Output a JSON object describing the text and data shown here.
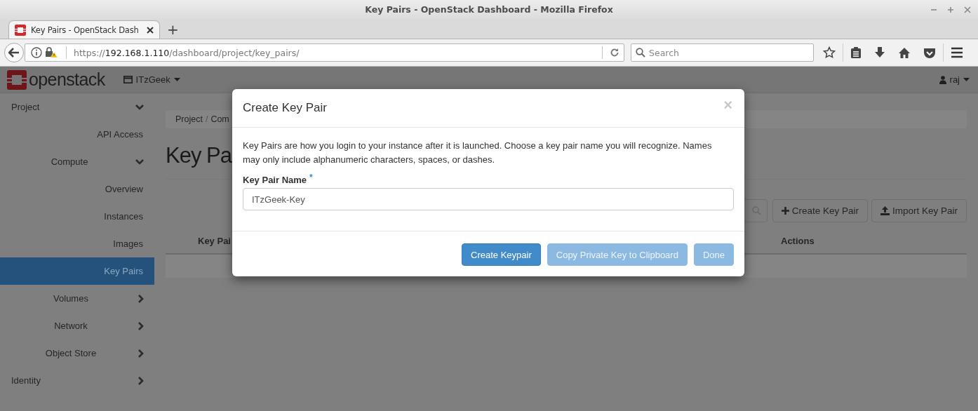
{
  "window": {
    "title": "Key Pairs - OpenStack Dashboard - Mozilla Firefox"
  },
  "tabs": [
    {
      "label": "Key Pairs - OpenStack Dash",
      "selected": true
    }
  ],
  "new_tab": "+",
  "address_bar": {
    "scheme": "https://",
    "host": "192.168.1.110",
    "path": "/dashboard/project/key_pairs/"
  },
  "search": {
    "placeholder": "Search"
  },
  "header": {
    "logo": "openstack",
    "project": "ITzGeek",
    "user": "raj"
  },
  "sidebar": {
    "items": [
      {
        "kind": "group",
        "label": "Project",
        "expanded": true,
        "children": [
          {
            "kind": "link",
            "label": "API Access",
            "selected": false
          },
          {
            "kind": "group",
            "label": "Compute",
            "expanded": true,
            "children": [
              {
                "kind": "link",
                "label": "Overview",
                "selected": false
              },
              {
                "kind": "link",
                "label": "Instances",
                "selected": false
              },
              {
                "kind": "link",
                "label": "Images",
                "selected": false
              },
              {
                "kind": "link",
                "label": "Key Pairs",
                "selected": true
              }
            ]
          },
          {
            "kind": "group",
            "label": "Volumes",
            "expanded": false
          },
          {
            "kind": "group",
            "label": "Network",
            "expanded": false
          },
          {
            "kind": "group",
            "label": "Object Store",
            "expanded": false
          }
        ]
      },
      {
        "kind": "group",
        "label": "Identity",
        "expanded": false
      }
    ]
  },
  "breadcrumb": {
    "items": [
      "Project",
      "Com"
    ],
    "separator": "/"
  },
  "page_title": "Key Pa",
  "actions": [
    {
      "label": "Create Key Pair",
      "kind": "create"
    },
    {
      "label": "Import Key Pair",
      "kind": "import"
    }
  ],
  "table": {
    "columns": [
      "Key Pai",
      "Actions"
    ]
  },
  "modal": {
    "title": "Create Key Pair",
    "close": "×",
    "description": "Key Pairs are how you login to your instance after it is launched. Choose a key pair name you will recognize. Names may only include alphanumeric characters, spaces, or dashes.",
    "field": {
      "label": "Key Pair Name",
      "required_mark": "*",
      "value": "ITzGeek-Key"
    },
    "buttons": [
      {
        "label": "Create Keypair",
        "kind": "primary",
        "disabled": false
      },
      {
        "label": "Copy Private Key to Clipboard",
        "kind": "primary",
        "disabled": true
      },
      {
        "label": "Done",
        "kind": "primary",
        "disabled": true
      }
    ]
  }
}
